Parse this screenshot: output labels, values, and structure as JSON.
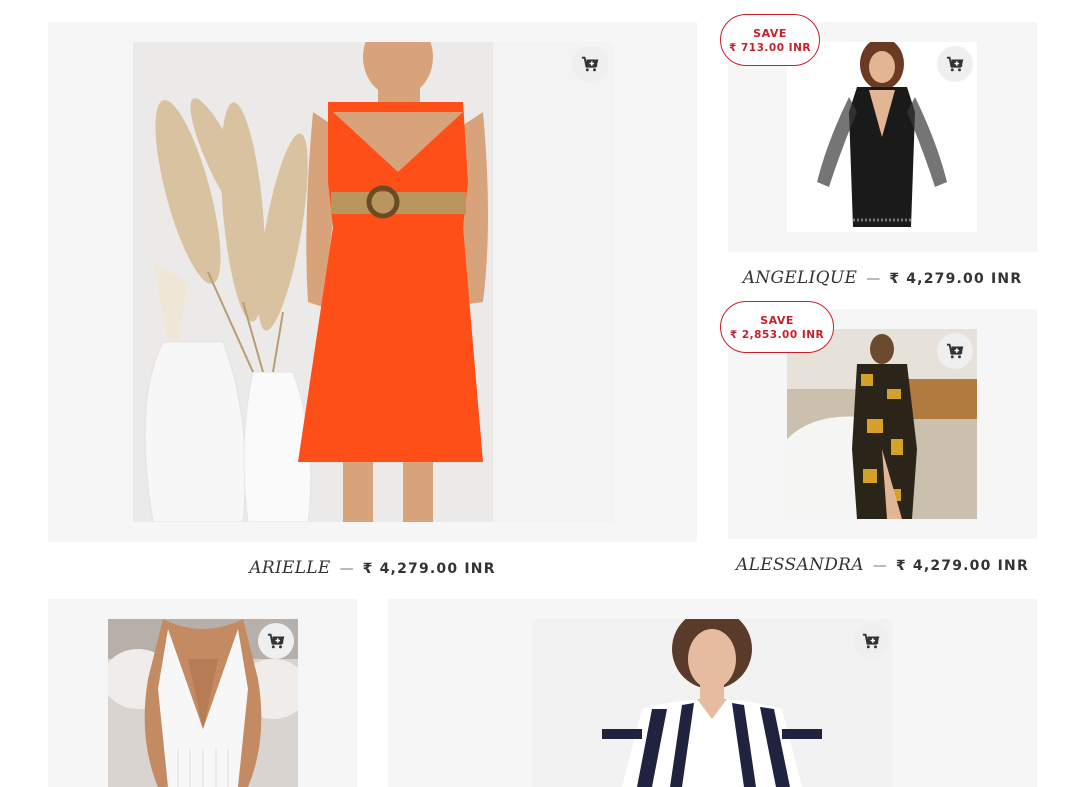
{
  "products": [
    {
      "name": "ARIELLE",
      "dash": "—",
      "price": "₹ 4,279.00 INR"
    },
    {
      "name": "ANGELIQUE",
      "dash": "—",
      "price": "₹ 4,279.00 INR",
      "save": {
        "label": "SAVE",
        "amount": "₹ 713.00 INR"
      }
    },
    {
      "name": "ALESSANDRA",
      "dash": "—",
      "price": "₹ 4,279.00 INR",
      "save": {
        "label": "SAVE",
        "amount": "₹ 2,853.00 INR"
      }
    }
  ],
  "icons": {
    "add_to_cart": "cart-plus-icon"
  },
  "colors": {
    "sale_red": "#c8202a",
    "card_bg": "#f6f6f6",
    "orange_dress": "#ff4f18"
  }
}
